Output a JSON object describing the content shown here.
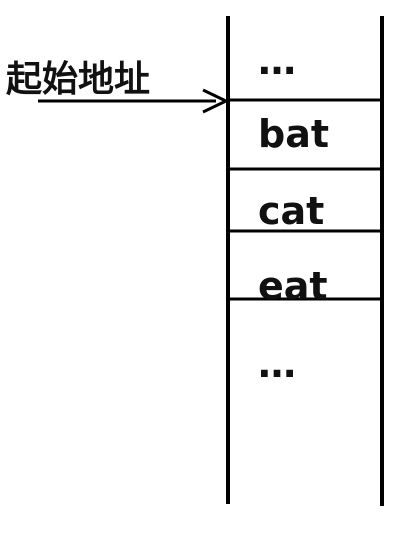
{
  "start_label": "起始地址",
  "cells": {
    "top": "…",
    "item1": "bat",
    "item2": "cat",
    "item3": "eat",
    "bottom": "…"
  }
}
